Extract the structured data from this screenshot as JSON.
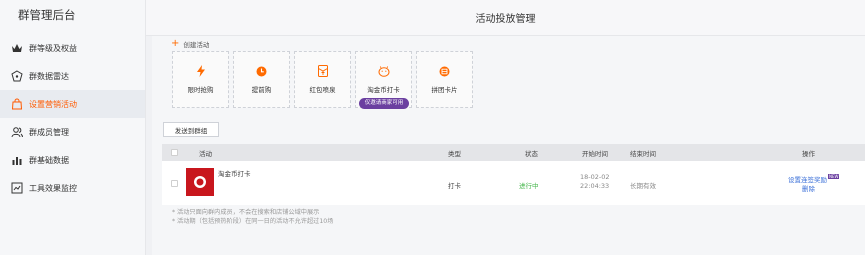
{
  "sidebar": {
    "title": "群管理后台",
    "items": [
      {
        "label": "群等级及权益",
        "icon": "crown-icon",
        "active": false
      },
      {
        "label": "群数据雷达",
        "icon": "radar-icon",
        "active": false
      },
      {
        "label": "设置营销活动",
        "icon": "bag-icon",
        "active": true
      },
      {
        "label": "群成员管理",
        "icon": "members-icon",
        "active": false
      },
      {
        "label": "群基础数据",
        "icon": "bar-chart-icon",
        "active": false
      },
      {
        "label": "工具效果监控",
        "icon": "monitor-icon",
        "active": false
      }
    ]
  },
  "header": {
    "title": "活动投放管理"
  },
  "create": {
    "label": "创建活动",
    "icon": "plus-icon"
  },
  "cards": [
    {
      "label": "限时抢购",
      "icon": "lightning-icon"
    },
    {
      "label": "提前购",
      "icon": "clock-icon"
    },
    {
      "label": "红包喷泉",
      "icon": "red-packet-icon"
    },
    {
      "label": "淘金币打卡",
      "icon": "pig-icon",
      "badge": "仅邀请商家可用"
    },
    {
      "label": "拼团卡片",
      "icon": "group-card-icon"
    }
  ],
  "send_button": "发送到群组",
  "table": {
    "headers": {
      "activity": "活动",
      "type": "类型",
      "status": "状态",
      "start": "开始时间",
      "end": "结束时间",
      "ops": "操作"
    },
    "rows": [
      {
        "name": "淘金币打卡",
        "type": "打卡",
        "status": "进行中",
        "start_date": "18-02-02",
        "start_time": "22:04:33",
        "end": "长期有效",
        "op_setup": "设置连签奖励",
        "op_new": "NEW",
        "op_delete": "删除"
      }
    ]
  },
  "notes": [
    "* 活动只面向群内成员，不会在搜索和店铺公域中展示",
    "* 活动期（包括预热阶段）在同一日的活动不允许超过10场"
  ],
  "colors": {
    "accent": "#ff5a00",
    "status_green": "#43b549",
    "link_blue": "#3a6fd8",
    "badge_purple": "#6b3fa0"
  }
}
